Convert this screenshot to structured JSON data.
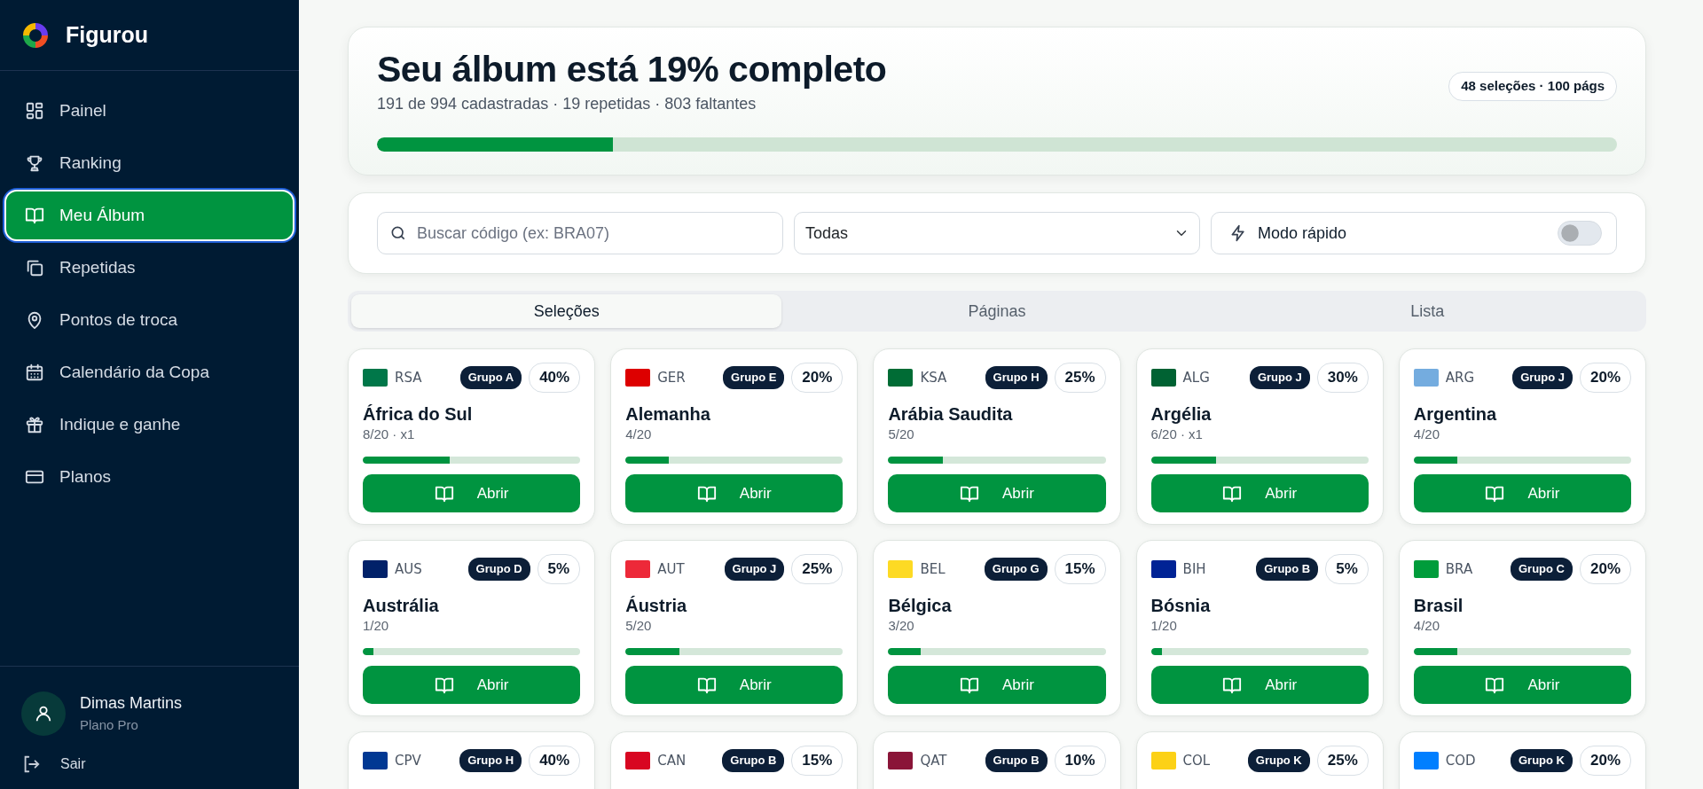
{
  "app": {
    "name": "Figurou"
  },
  "sidebar": {
    "items": [
      {
        "label": "Painel",
        "selected": false
      },
      {
        "label": "Ranking",
        "selected": false
      },
      {
        "label": "Meu Álbum",
        "selected": true
      },
      {
        "label": "Repetidas",
        "selected": false
      },
      {
        "label": "Pontos de troca",
        "selected": false
      },
      {
        "label": "Calendário da Copa",
        "selected": false
      },
      {
        "label": "Indique e ganhe",
        "selected": false
      },
      {
        "label": "Planos",
        "selected": false
      }
    ],
    "user": {
      "name": "Dimas Martins",
      "plan": "Plano Pro"
    },
    "logout": "Sair"
  },
  "summary": {
    "title": "Seu álbum está 19% completo",
    "subtitle": "191 de 994 cadastradas · 19 repetidas · 803 faltantes",
    "badge": "48 seleções · 100 págs",
    "level": 0.19
  },
  "filters": {
    "search": {
      "placeholder": "Buscar código (ex: BRA07)"
    },
    "group_select": {
      "value": "Todas"
    },
    "quick_mode": {
      "label": "Modo rápido",
      "on": false
    }
  },
  "tabs": [
    {
      "label": "Seleções",
      "selected": true
    },
    {
      "label": "Páginas",
      "selected": false
    },
    {
      "label": "Lista",
      "selected": false
    }
  ],
  "teams": [
    {
      "code": "RSA",
      "group": "Grupo A",
      "percent": "40%",
      "name": "África do Sul",
      "count": "8/20 · x1",
      "level": 0.4,
      "button": "Abrir",
      "color": "#007749"
    },
    {
      "code": "GER",
      "group": "Grupo E",
      "percent": "20%",
      "name": "Alemanha",
      "count": "4/20",
      "level": 0.2,
      "button": "Abrir",
      "color": "#dd0000"
    },
    {
      "code": "KSA",
      "group": "Grupo H",
      "percent": "25%",
      "name": "Arábia Saudita",
      "count": "5/20",
      "level": 0.25,
      "button": "Abrir",
      "color": "#006c35"
    },
    {
      "code": "ALG",
      "group": "Grupo J",
      "percent": "30%",
      "name": "Argélia",
      "count": "6/20 · x1",
      "level": 0.3,
      "button": "Abrir",
      "color": "#006233"
    },
    {
      "code": "ARG",
      "group": "Grupo J",
      "percent": "20%",
      "name": "Argentina",
      "count": "4/20",
      "level": 0.2,
      "button": "Abrir",
      "color": "#74acdf"
    },
    {
      "code": "AUS",
      "group": "Grupo D",
      "percent": "5%",
      "name": "Austrália",
      "count": "1/20",
      "level": 0.05,
      "button": "Abrir",
      "color": "#012169"
    },
    {
      "code": "AUT",
      "group": "Grupo J",
      "percent": "25%",
      "name": "Áustria",
      "count": "5/20",
      "level": 0.25,
      "button": "Abrir",
      "color": "#ed2939"
    },
    {
      "code": "BEL",
      "group": "Grupo G",
      "percent": "15%",
      "name": "Bélgica",
      "count": "3/20",
      "level": 0.15,
      "button": "Abrir",
      "color": "#fdda24"
    },
    {
      "code": "BIH",
      "group": "Grupo B",
      "percent": "5%",
      "name": "Bósnia",
      "count": "1/20",
      "level": 0.05,
      "button": "Abrir",
      "color": "#002395"
    },
    {
      "code": "BRA",
      "group": "Grupo C",
      "percent": "20%",
      "name": "Brasil",
      "count": "4/20",
      "level": 0.2,
      "button": "Abrir",
      "color": "#009c3b"
    },
    {
      "code": "CPV",
      "group": "Grupo H",
      "percent": "40%",
      "color": "#003893"
    },
    {
      "code": "CAN",
      "group": "Grupo B",
      "percent": "15%",
      "color": "#d80621"
    },
    {
      "code": "QAT",
      "group": "Grupo B",
      "percent": "10%",
      "color": "#8a1538"
    },
    {
      "code": "COL",
      "group": "Grupo K",
      "percent": "25%",
      "color": "#fcd116"
    },
    {
      "code": "COD",
      "group": "Grupo K",
      "percent": "20%",
      "color": "#007fff"
    }
  ]
}
